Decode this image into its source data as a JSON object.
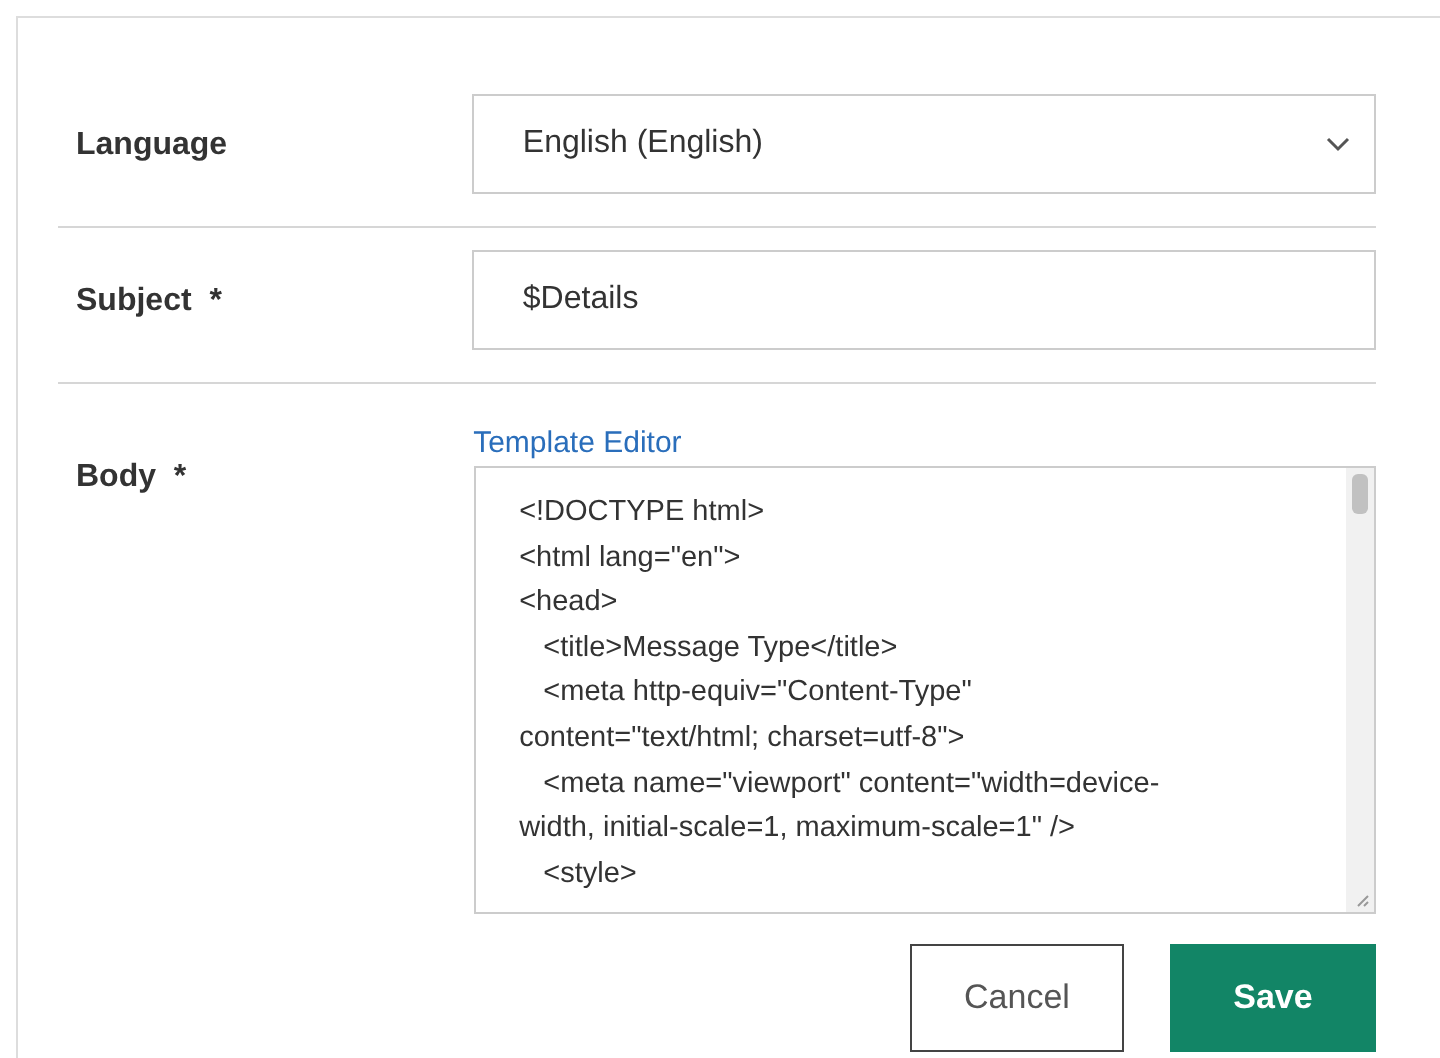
{
  "form": {
    "rows": [
      {
        "kind": "select",
        "label": "Language",
        "value": "English (English)"
      },
      {
        "kind": "text",
        "label": "Subject",
        "required_mark": "*",
        "value": "$Details"
      },
      {
        "kind": "code",
        "label": "Body",
        "required_mark": "*",
        "link": "Template Editor",
        "value": "<!DOCTYPE html>\n<html lang=\"en\">\n<head>\n   <title>Message Type</title>\n   <meta http-equiv=\"Content-Type\"\ncontent=\"text/html; charset=utf-8\">\n   <meta name=\"viewport\" content=\"width=device-\nwidth, initial-scale=1, maximum-scale=1\" />\n   <style>"
      }
    ]
  },
  "buttons": [
    {
      "kind": "secondary",
      "label": "Cancel"
    },
    {
      "kind": "primary",
      "label": "Save"
    }
  ]
}
